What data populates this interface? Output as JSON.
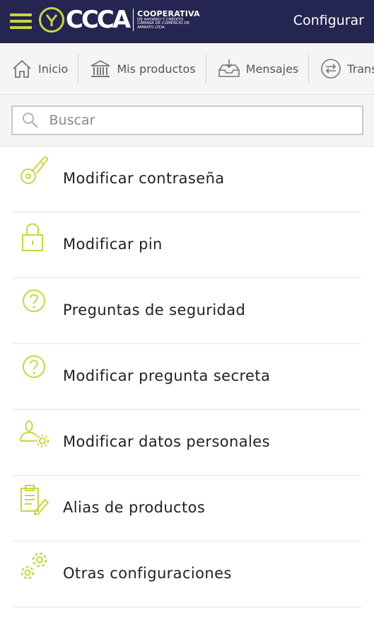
{
  "header": {
    "logo_text": "CCCA",
    "logo_sub_big": "COOPERATIVA",
    "logo_sub_small": "DE AHORRO Y CRÉDITO CÁMARA DE COMERCIO DE AMBATO LTDA.",
    "configurar_label": "Configurar",
    "brand_color": "#242550",
    "accent_color": "#c8d545"
  },
  "nav": {
    "items": [
      {
        "label": "Inicio",
        "icon": "home-icon"
      },
      {
        "label": "Mis productos",
        "icon": "bank-icon"
      },
      {
        "label": "Mensajes",
        "icon": "inbox-icon"
      },
      {
        "label": "Transferencias",
        "icon": "transfer-icon"
      }
    ]
  },
  "search": {
    "placeholder": "Buscar"
  },
  "menu": {
    "items": [
      {
        "label": "Modificar contraseña",
        "icon": "key-icon"
      },
      {
        "label": "Modificar pin",
        "icon": "lock-icon"
      },
      {
        "label": "Preguntas de seguridad",
        "icon": "question-icon"
      },
      {
        "label": "Modificar pregunta secreta",
        "icon": "question-icon"
      },
      {
        "label": "Modificar datos personales",
        "icon": "user-gear-icon"
      },
      {
        "label": "Alias de productos",
        "icon": "clipboard-edit-icon"
      },
      {
        "label": "Otras configuraciones",
        "icon": "gears-icon"
      }
    ]
  }
}
